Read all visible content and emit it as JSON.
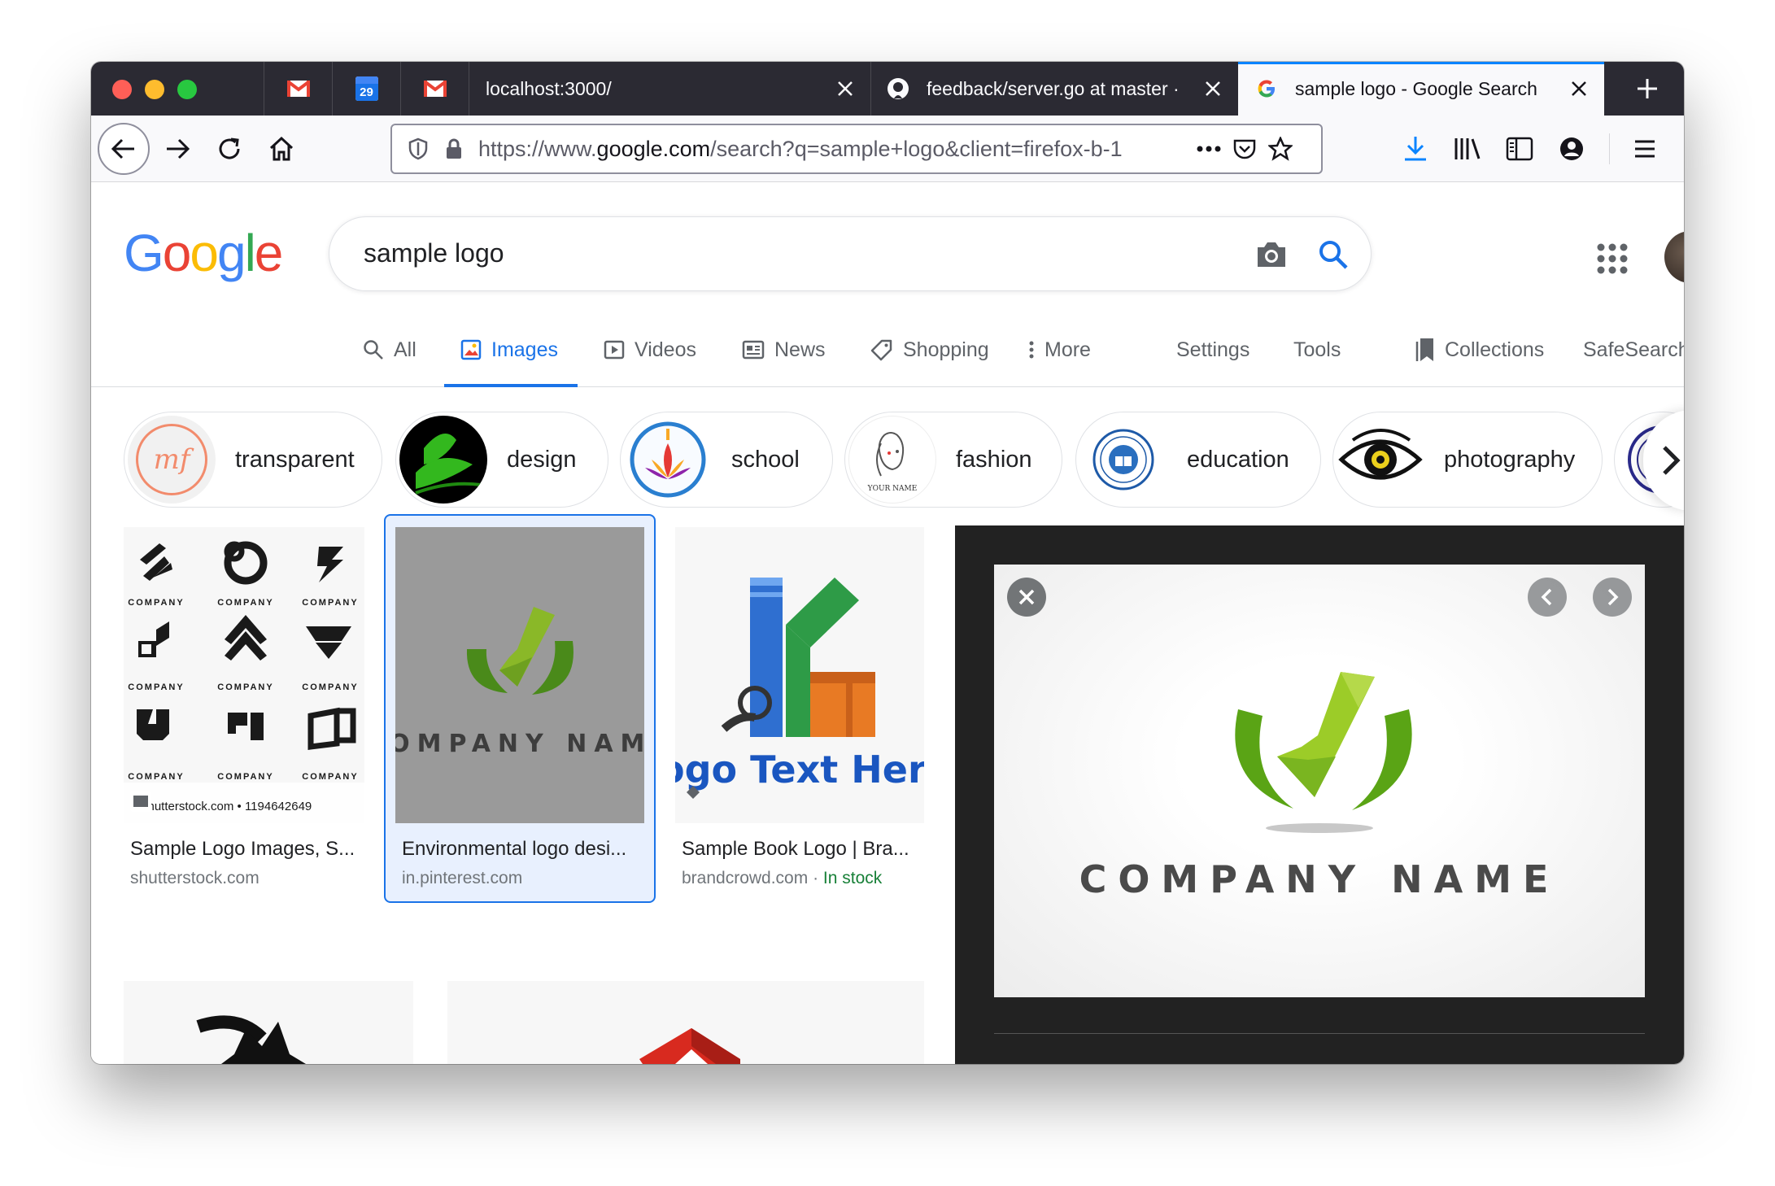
{
  "tabs": [
    {
      "title": ""
    },
    {
      "title": "",
      "badge": "29"
    },
    {
      "title": ""
    },
    {
      "title": "localhost:3000/"
    },
    {
      "title": "feedback/server.go at master · "
    },
    {
      "title": "sample logo - Google Search"
    }
  ],
  "urlbar": {
    "prefix": "https://www.",
    "host": "google.com",
    "path": "/search?q=sample+logo&client=firefox-b-1"
  },
  "google": {
    "logo_letters": [
      "G",
      "o",
      "o",
      "g",
      "l",
      "e"
    ],
    "query": "sample logo"
  },
  "search_tabs": [
    {
      "label": "All",
      "icon": "search-icon"
    },
    {
      "label": "Images",
      "icon": "image-icon"
    },
    {
      "label": "Videos",
      "icon": "play-icon"
    },
    {
      "label": "News",
      "icon": "news-icon"
    },
    {
      "label": "Shopping",
      "icon": "tag-icon"
    },
    {
      "label": "More",
      "icon": "more-vert-icon"
    },
    {
      "label": "Settings"
    },
    {
      "label": "Tools"
    },
    {
      "label": "Collections",
      "icon": "bookmark-icon"
    },
    {
      "label": "SafeSearch"
    }
  ],
  "chips": [
    {
      "label": "transparent",
      "thumb": "mf"
    },
    {
      "label": "design"
    },
    {
      "label": "school"
    },
    {
      "label": "fashion",
      "thumb": "YOUR NAME"
    },
    {
      "label": "education"
    },
    {
      "label": "photography"
    }
  ],
  "results": [
    {
      "title": "Sample Logo Images, S...",
      "source": "shutterstock.com",
      "overlay": "shutterstock.com • 1194642649",
      "logo_label": "COMPANY"
    },
    {
      "title": "Environmental logo desi...",
      "source": "in.pinterest.com",
      "logo_text": "COMPANY NAME"
    },
    {
      "title": "Sample Book Logo | Bra...",
      "source": "brandcrowd.com",
      "source_sep": " · ",
      "stock": "In stock",
      "logo_text": "ogo Text Here"
    }
  ],
  "preview": {
    "company": "COMPANY NAME"
  },
  "colors": {
    "accent": "#1a73e8",
    "google_blue": "#4285f4",
    "google_red": "#ea4335",
    "google_yellow": "#fbbc05",
    "google_green": "#34a853",
    "leaf_green": "#5aa415"
  }
}
